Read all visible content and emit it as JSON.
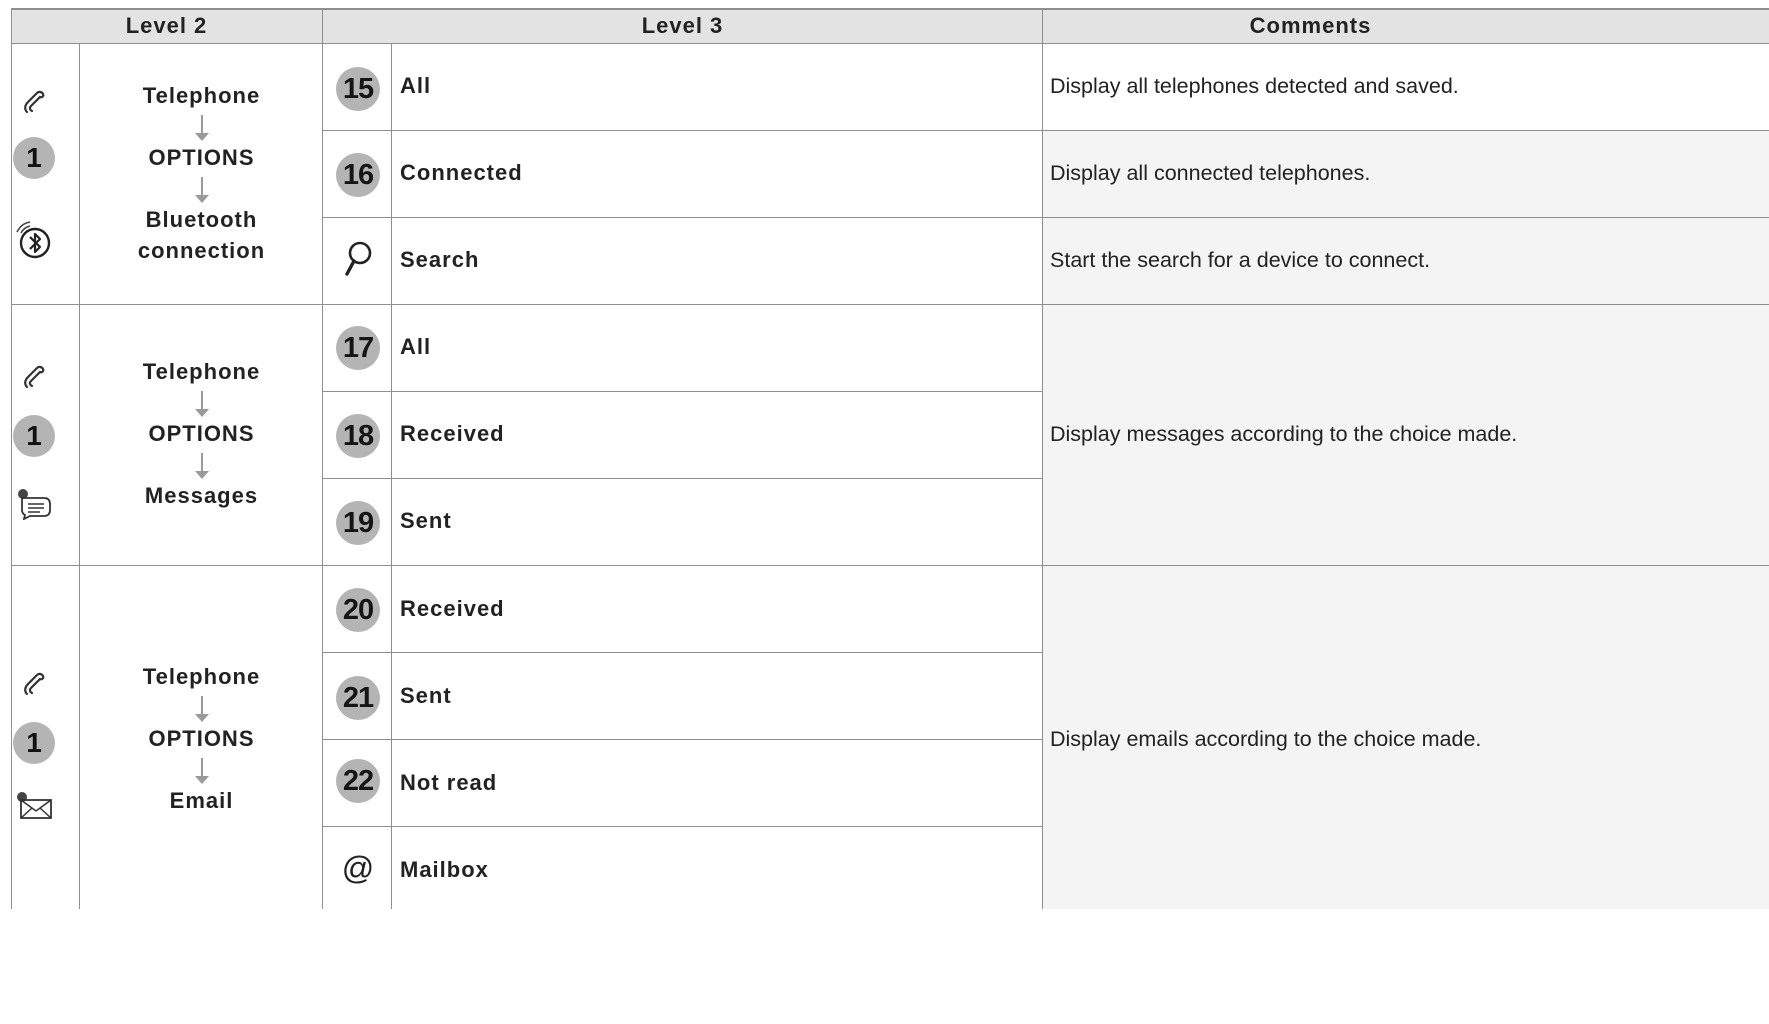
{
  "headers": {
    "level2": "Level 2",
    "level3": "Level 3",
    "comments": "Comments"
  },
  "groups": [
    {
      "icons": [
        "phone-icon",
        "bluetooth-icon"
      ],
      "badge": "1",
      "path": [
        "Telephone",
        "OPTIONS",
        "Bluetooth connection"
      ],
      "items": [
        {
          "number": "15",
          "label": "All"
        },
        {
          "number": "16",
          "label": "Connected"
        },
        {
          "icon": "search-icon",
          "label": "Search"
        }
      ],
      "comments": [
        "Display all telephones detected and saved.",
        "Display all connected telephones.",
        "Start the search for a device to connect."
      ]
    },
    {
      "icons": [
        "phone-icon",
        "messages-icon"
      ],
      "badge": "1",
      "path": [
        "Telephone",
        "OPTIONS",
        "Messages"
      ],
      "items": [
        {
          "number": "17",
          "label": "All"
        },
        {
          "number": "18",
          "label": "Received"
        },
        {
          "number": "19",
          "label": "Sent"
        }
      ],
      "comment": "Display messages according to the choice made."
    },
    {
      "icons": [
        "phone-icon",
        "email-icon"
      ],
      "badge": "1",
      "path": [
        "Telephone",
        "OPTIONS",
        "Email"
      ],
      "items": [
        {
          "number": "20",
          "label": "Received"
        },
        {
          "number": "21",
          "label": "Sent"
        },
        {
          "number": "22",
          "label": "Not read"
        },
        {
          "icon": "at-sign-icon",
          "symbol": "@",
          "label": "Mailbox"
        }
      ],
      "comment": "Display emails according to the choice made."
    }
  ]
}
